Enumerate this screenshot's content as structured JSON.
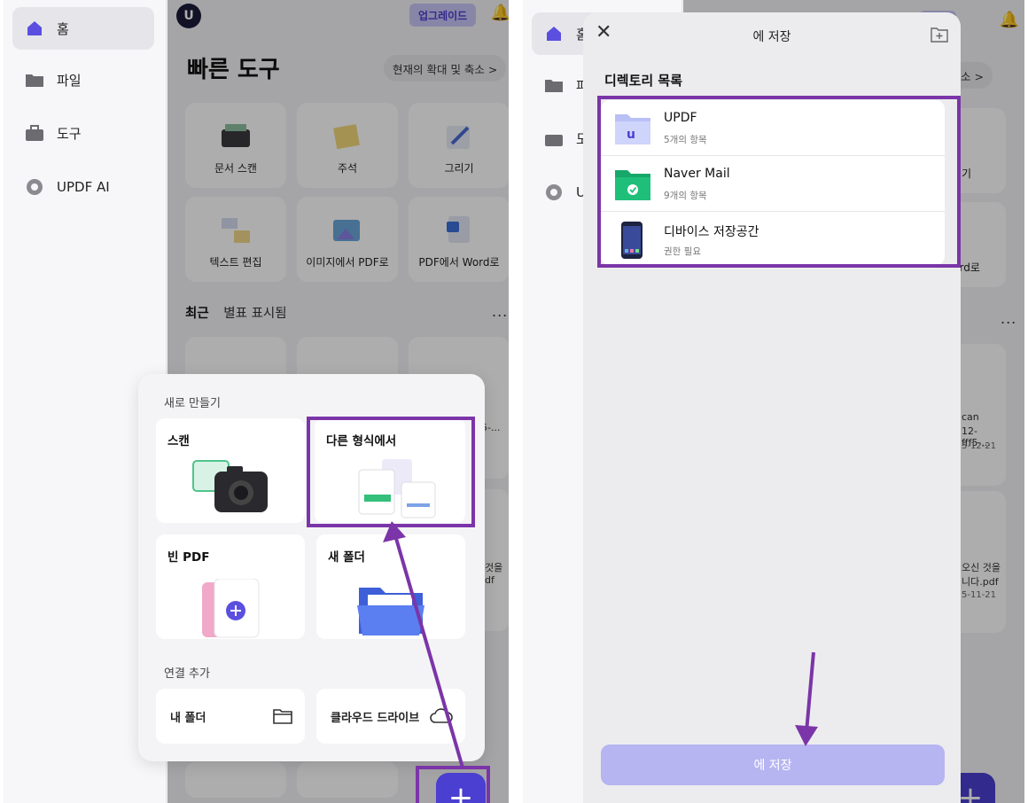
{
  "colors": {
    "accent": "#4a3fd0",
    "highlight": "#7b35a8",
    "save_disabled": "#b7b4f2",
    "folder_updf": "#b9c0f5",
    "folder_naver": "#1fbf7a"
  },
  "left": {
    "sidebar": {
      "items": [
        {
          "label": "홈",
          "icon": "home-icon"
        },
        {
          "label": "파일",
          "icon": "folder-icon"
        },
        {
          "label": "도구",
          "icon": "toolbox-icon"
        },
        {
          "label": "UPDF AI",
          "icon": "ai-icon"
        }
      ]
    },
    "header": {
      "upgrade_label": "업그레이드"
    },
    "main": {
      "title": "빠른 도구",
      "zoom_label": "현재의 확대 및 축소 >",
      "tools": [
        {
          "label": "문서 스캔",
          "icon": "scanner-icon"
        },
        {
          "label": "주석",
          "icon": "sticky-note-icon"
        },
        {
          "label": "그리기",
          "icon": "pen-icon"
        },
        {
          "label": "텍스트 편집",
          "icon": "text-edit-icon"
        },
        {
          "label": "이미지에서 PDF로",
          "icon": "image-icon"
        },
        {
          "label": "PDF에서 Word로",
          "icon": "word-icon"
        }
      ],
      "recent_tab": "최근",
      "starred_tab": "별표 표시됨",
      "more": "...",
      "bg_file_texts": [
        "5-...",
        "것을",
        "df"
      ]
    },
    "popup": {
      "new_section": "새로 만들기",
      "cards": {
        "scan": "스캔",
        "from_other": "다른 형식에서",
        "blank_pdf": "빈 PDF",
        "new_folder": "새 폴더"
      },
      "connect_section": "연결 추가",
      "my_folder": "내 폴더",
      "cloud_drive": "클라우드 드라이브"
    },
    "fab_label": "+"
  },
  "right": {
    "sidebar_items": [
      "홈",
      "파",
      "도",
      "UP"
    ],
    "upgrade_partial": "이드",
    "zoom_partial": "및 축소 >",
    "tool_partial": [
      "리기",
      "Word로"
    ],
    "files": [
      {
        "name1": "can",
        "name2": "12-fff5-...",
        "date": "5-12-21"
      },
      {
        "name1": "오신 것을",
        "name2": "니다.pdf",
        "date": "5-11-21"
      }
    ],
    "sheet": {
      "title": "에 저장",
      "dir_title": "디렉토리 목록",
      "dirs": [
        {
          "name": "UPDF",
          "sub": "5개의 항목",
          "icon": "updf-folder-icon"
        },
        {
          "name": "Naver Mail",
          "sub": "9개의 항목",
          "icon": "naver-folder-icon"
        },
        {
          "name": "디바이스 저장공간",
          "sub": "권한 필요",
          "icon": "phone-icon"
        }
      ],
      "save_label": "에 저장"
    },
    "fab_label": "+"
  }
}
